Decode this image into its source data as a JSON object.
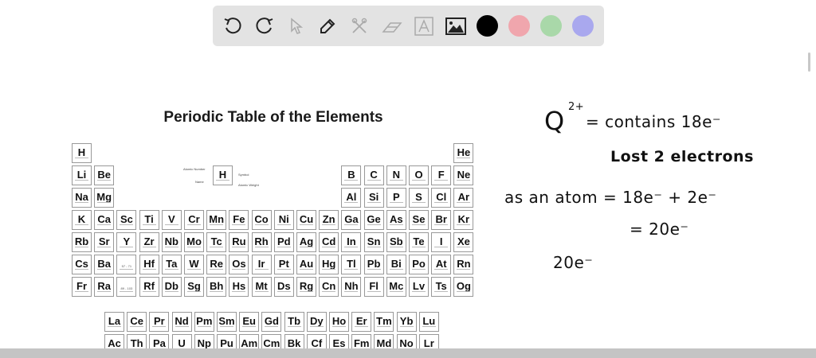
{
  "toolbar": {
    "tools": [
      "undo-icon",
      "redo-icon",
      "select-icon",
      "pen-icon",
      "tools-icon",
      "eraser-icon",
      "text-icon",
      "image-icon"
    ],
    "colors": [
      "#000000",
      "#f0a6ad",
      "#a9d8a9",
      "#a9a8ee"
    ]
  },
  "periodic_table": {
    "title": "Periodic Table of the Elements",
    "rows": [
      [
        "H",
        "",
        "",
        "",
        "",
        "",
        "",
        "",
        "",
        "",
        "",
        "",
        "",
        "",
        "",
        "",
        "",
        "He"
      ],
      [
        "Li",
        "Be",
        "",
        "",
        "",
        "",
        "",
        "",
        "",
        "",
        "",
        "",
        "B",
        "C",
        "N",
        "O",
        "F",
        "Ne"
      ],
      [
        "Na",
        "Mg",
        "",
        "",
        "",
        "",
        "",
        "",
        "",
        "",
        "",
        "",
        "Al",
        "Si",
        "P",
        "S",
        "Cl",
        "Ar"
      ],
      [
        "K",
        "Ca",
        "Sc",
        "Ti",
        "V",
        "Cr",
        "Mn",
        "Fe",
        "Co",
        "Ni",
        "Cu",
        "Zn",
        "Ga",
        "Ge",
        "As",
        "Se",
        "Br",
        "Kr"
      ],
      [
        "Rb",
        "Sr",
        "Y",
        "Zr",
        "Nb",
        "Mo",
        "Tc",
        "Ru",
        "Rh",
        "Pd",
        "Ag",
        "Cd",
        "In",
        "Sn",
        "Sb",
        "Te",
        "I",
        "Xe"
      ],
      [
        "Cs",
        "Ba",
        "57 - 71",
        "Hf",
        "Ta",
        "W",
        "Re",
        "Os",
        "Ir",
        "Pt",
        "Au",
        "Hg",
        "Tl",
        "Pb",
        "Bi",
        "Po",
        "At",
        "Rn"
      ],
      [
        "Fr",
        "Ra",
        "89 - 103",
        "Rf",
        "Db",
        "Sg",
        "Bh",
        "Hs",
        "Mt",
        "Ds",
        "Rg",
        "Cn",
        "Nh",
        "Fl",
        "Mc",
        "Lv",
        "Ts",
        "Og"
      ]
    ],
    "lanthanides": [
      "La",
      "Ce",
      "Pr",
      "Nd",
      "Pm",
      "Sm",
      "Eu",
      "Gd",
      "Tb",
      "Dy",
      "Ho",
      "Er",
      "Tm",
      "Yb",
      "Lu"
    ],
    "actinides": [
      "Ac",
      "Th",
      "Pa",
      "U",
      "Np",
      "Pu",
      "Am",
      "Cm",
      "Bk",
      "Cf",
      "Es",
      "Fm",
      "Md",
      "No",
      "Lr"
    ],
    "legend": {
      "symbol": "H",
      "atomic_number_label": "Atomic Number",
      "name_label": "Name",
      "symbol_label": "Symbol",
      "weight_label": "Atomic Weight"
    }
  },
  "notes": {
    "line1_q": "Q",
    "line1_charge": "2+",
    "line1_rest": "= contains 18e⁻",
    "line2": "Lost 2 electrons",
    "line3": "as an atom = 18e⁻ + 2e⁻",
    "line4": "= 20e⁻",
    "line5": "20e⁻"
  }
}
